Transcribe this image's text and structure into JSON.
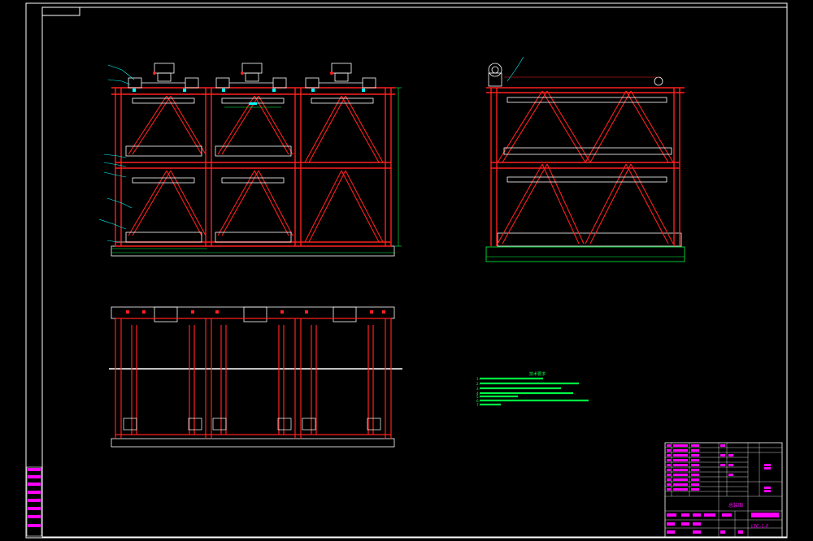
{
  "colors": {
    "background": "#000000",
    "frame": "#ffffff",
    "structure": "#ff2020",
    "dimension": "#00ff44",
    "annotation": "#00ffff",
    "title_block": "#ff00ff",
    "hardware": "#ffffff"
  },
  "tech_notes": {
    "title": "技术要求",
    "lines": [
      "1.",
      "2.",
      "3.",
      "4.",
      "5.",
      "6.",
      "7."
    ]
  },
  "title_block": {
    "drawing_no": "LTC-1-F",
    "name": "总装图"
  },
  "views": {
    "front": "front-elevation",
    "side": "side-elevation",
    "plan": "plan-view"
  }
}
